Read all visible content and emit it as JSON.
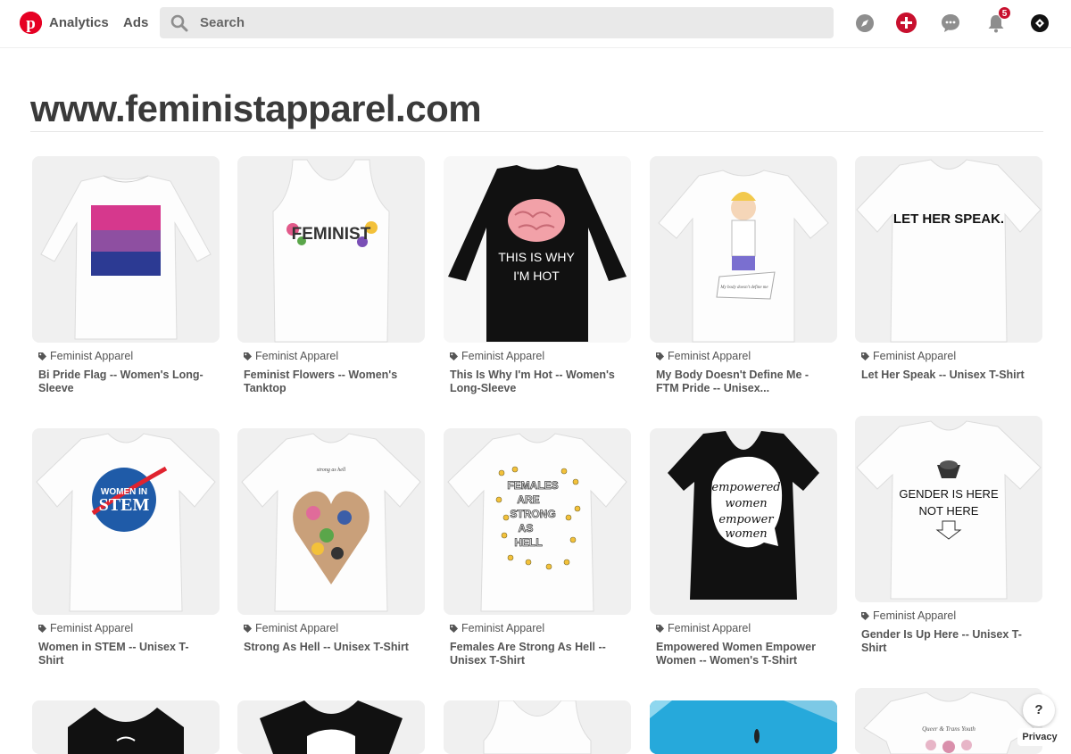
{
  "header": {
    "nav": [
      "Analytics",
      "Ads"
    ],
    "search_placeholder": "Search",
    "notifications_count": "5",
    "brand_color": "#e60023"
  },
  "page": {
    "title": "www.feministapparel.com"
  },
  "pins": [
    {
      "source": "Feminist Apparel",
      "title": "Bi Pride Flag -- Women's Long-Sleeve",
      "image": "white long-sleeve shirt with bi pride flag"
    },
    {
      "source": "Feminist Apparel",
      "title": "Feminist Flowers -- Women's Tanktop",
      "image_text": "FEMINIST"
    },
    {
      "source": "Feminist Apparel",
      "title": "This Is Why I'm Hot -- Women's Long-Sleeve",
      "image_text": [
        "THIS IS WHY",
        "I'M HOT"
      ]
    },
    {
      "source": "Feminist Apparel",
      "title": "My Body Doesn't Define Me - FTM Pride -- Unisex...",
      "image_text": "My body doesn't define me"
    },
    {
      "source": "Feminist Apparel",
      "title": "Let Her Speak -- Unisex T-Shirt",
      "image_text": "LET HER SPEAK."
    },
    {
      "source": "Feminist Apparel",
      "title": "Women in STEM -- Unisex T-Shirt",
      "image_text": [
        "WOMEN IN",
        "STEM"
      ]
    },
    {
      "source": "Feminist Apparel",
      "title": "Strong As Hell -- Unisex T-Shirt",
      "image_text": "strong as hell"
    },
    {
      "source": "Feminist Apparel",
      "title": "Females Are Strong As Hell -- Unisex T-Shirt",
      "image_text": [
        "FEMALES",
        "ARE",
        "STRONG",
        "AS",
        "HELL"
      ]
    },
    {
      "source": "Feminist Apparel",
      "title": "Empowered Women Empower Women -- Women's T-Shirt",
      "image_text": [
        "empowered",
        "women",
        "empower",
        "women"
      ]
    },
    {
      "source": "Feminist Apparel",
      "title": "Gender Is Up Here -- Unisex T-Shirt",
      "image_text": [
        "GENDER IS HERE",
        "NOT HERE"
      ]
    }
  ],
  "bottom_row": [
    {
      "image": "black t-shirt"
    },
    {
      "image": "black t-shirt"
    },
    {
      "image": "white tank top"
    },
    {
      "image": "blue pool photo"
    },
    {
      "image": "white t-shirt with flowers",
      "image_text": "Queer & Trans Youth"
    }
  ],
  "footer": {
    "help_label": "?",
    "privacy_label": "Privacy"
  }
}
